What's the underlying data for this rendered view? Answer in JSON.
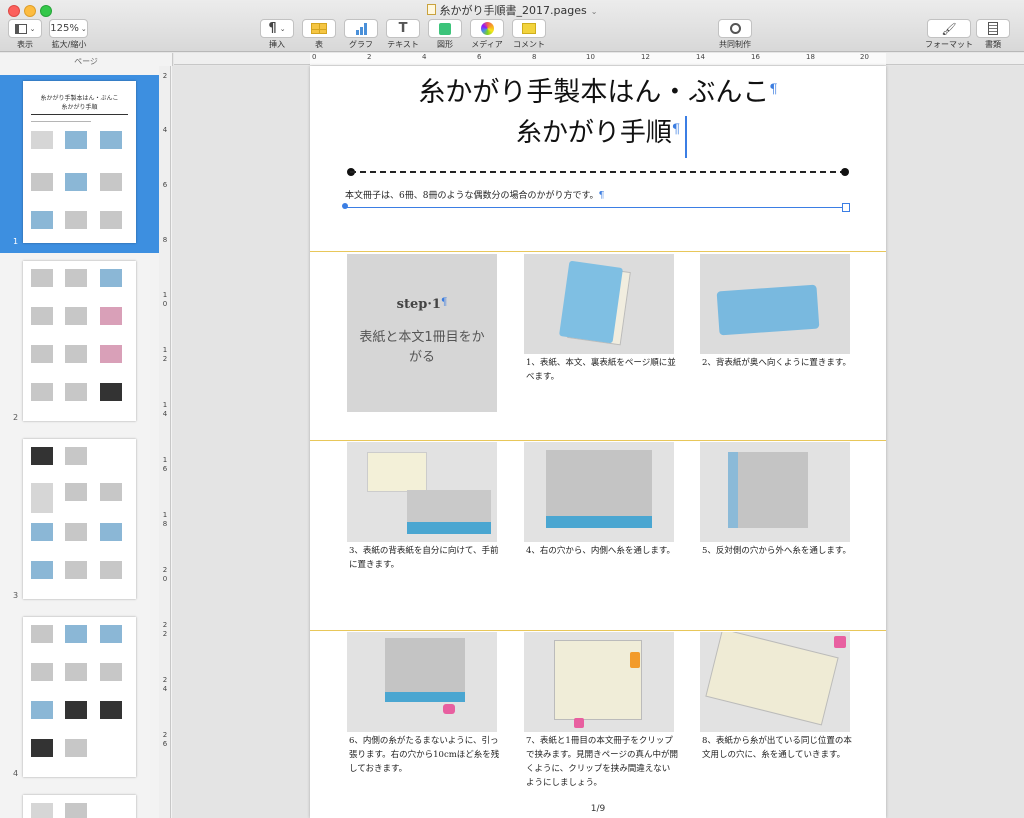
{
  "window": {
    "title": "糸かがり手順書_2017.pages",
    "controls": [
      "close",
      "minimize",
      "zoom"
    ]
  },
  "toolbar": {
    "view_label": "表示",
    "zoom_value": "125%",
    "zoom_label": "拡大/縮小",
    "insert_label": "挿入",
    "table_label": "表",
    "chart_label": "グラフ",
    "text_label": "テキスト",
    "shape_label": "図形",
    "media_label": "メディア",
    "comment_label": "コメント",
    "collaborate_label": "共同制作",
    "format_label": "フォーマット",
    "document_label": "書類",
    "accent_colors": {
      "table": "#f5c542",
      "chart": "#4a90d9",
      "shape": "#3cc47a",
      "comment": "#f2d33c"
    }
  },
  "sidebar": {
    "header": "ページ",
    "pages": [
      {
        "number": "1",
        "selected": true
      },
      {
        "number": "2",
        "selected": false
      },
      {
        "number": "3",
        "selected": false
      },
      {
        "number": "4",
        "selected": false
      }
    ],
    "thumb1_title": "糸かがり手製本はん・ぶんこ",
    "thumb1_subtitle": "糸かがり手順",
    "thumb1_step": "step1\n表紙と本文1冊目をかがる"
  },
  "ruler": {
    "horizontal": [
      "0",
      "2",
      "4",
      "6",
      "8",
      "10",
      "12",
      "14",
      "16",
      "18",
      "20"
    ],
    "vertical": [
      "2",
      "4",
      "6",
      "8",
      "10",
      "12",
      "14",
      "16",
      "18",
      "20",
      "22",
      "24",
      "26"
    ]
  },
  "document": {
    "title": "糸かがり手製本はん・ぶんこ",
    "subtitle": "糸かがり手順",
    "intro": "本文冊子は、6冊、8冊のような偶数分の場合のかがり方です。",
    "pilcrow": "¶",
    "step": {
      "heading": "step·1",
      "text": "表紙と本文1冊目をかがる"
    },
    "steps": [
      {
        "caption": "1、表紙、本文、裏表紙をページ順に並べます。"
      },
      {
        "caption": "2、背表紙が奥へ向くように置きます。"
      },
      {
        "caption": "3、表紙の背表紙を自分に向けて、手前に置きます。"
      },
      {
        "caption": "4、右の穴から、内側へ糸を通します。"
      },
      {
        "caption": "5、反対側の穴から外へ糸を通します。"
      },
      {
        "caption": "6、内側の糸がたるまないように、引っ張ります。右の穴から10cmほど糸を残しておきます。"
      },
      {
        "caption": "7、表紙と1冊目の本文冊子をクリップで挟みます。見開きページの真ん中が開くように、クリップを挟み間違えないようにしましょう。"
      },
      {
        "caption": "8、表紙から糸が出ている同じ位置の本文用しの穴に、糸を通していきます。"
      }
    ],
    "page_indicator": "1/9"
  }
}
